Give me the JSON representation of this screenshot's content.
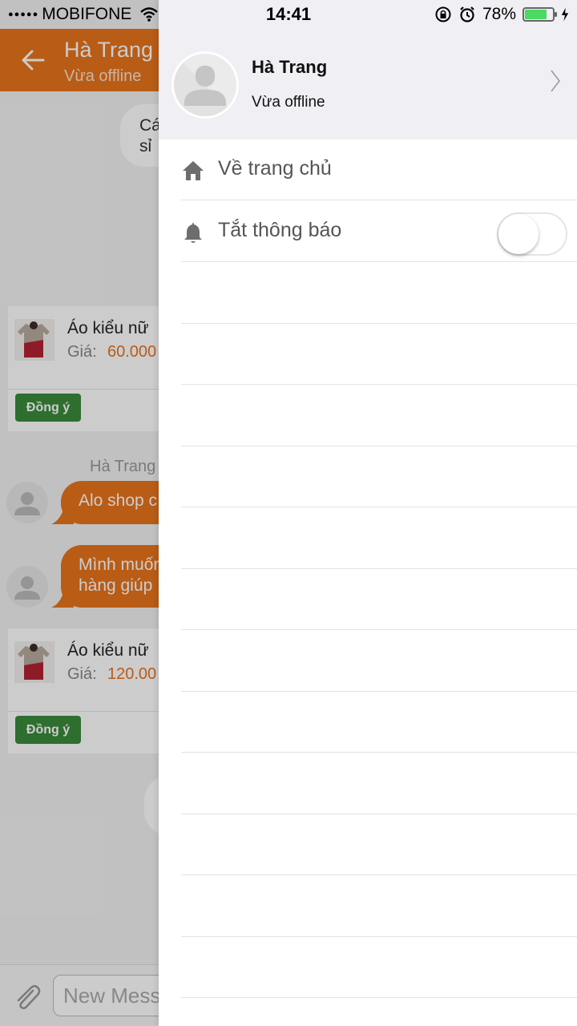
{
  "status_bar": {
    "carrier": "MOBIFONE",
    "time": "14:41",
    "battery": "78%",
    "battery_level": 0.78
  },
  "chat": {
    "title": "Hà Trang",
    "subtitle": "Vừa offline",
    "grey_bubble_text": "Cá\nsỉ",
    "sender_name": "Hà Trang",
    "products": [
      {
        "name": "Áo kiểu nữ",
        "price_label": "Giá:",
        "price": "60.000",
        "button": "Đồng ý"
      },
      {
        "name": "Áo kiểu nữ",
        "price_label": "Giá:",
        "price": "120.00",
        "button": "Đồng ý"
      }
    ],
    "messages": [
      {
        "text": "Alo shop c"
      },
      {
        "text": "Mình muốn\nhàng giúp"
      }
    ],
    "input_placeholder": "New Mess"
  },
  "drawer": {
    "profile_name": "Hà Trang",
    "profile_status": "Vừa offline",
    "menu": [
      {
        "label": "Về trang chủ",
        "icon": "home-icon"
      },
      {
        "label": "Tắt thông báo",
        "icon": "bell-icon",
        "toggle_on": false
      }
    ]
  },
  "colors": {
    "accent": "#e8731c",
    "agree_button": "#3a8a3a",
    "drawer_header": "#efeff4"
  }
}
